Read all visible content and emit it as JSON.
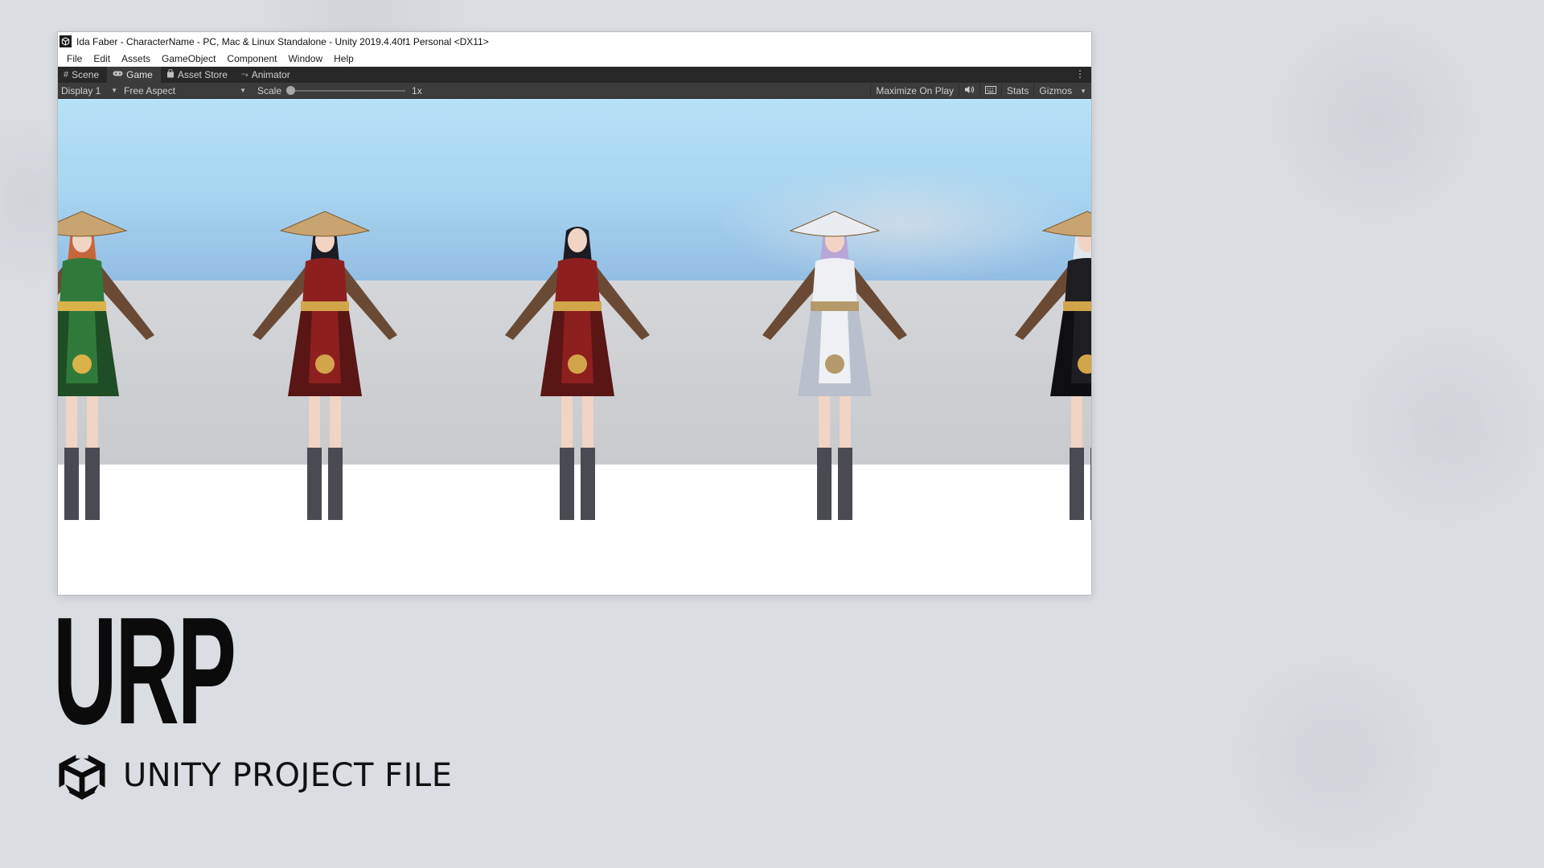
{
  "window": {
    "title": "Ida Faber - CharacterName - PC, Mac & Linux Standalone - Unity 2019.4.40f1 Personal <DX11>",
    "app_icon": "unity-icon"
  },
  "menu": [
    "File",
    "Edit",
    "Assets",
    "GameObject",
    "Component",
    "Window",
    "Help"
  ],
  "tabs": [
    {
      "label": "Scene",
      "icon": "grid-icon",
      "glyph": "#"
    },
    {
      "label": "Game",
      "icon": "gamepad-icon",
      "glyph": "🎮",
      "active": true
    },
    {
      "label": "Asset Store",
      "icon": "bag-icon",
      "glyph": "🔒"
    },
    {
      "label": "Animator",
      "icon": "animator-icon",
      "glyph": "⤳"
    }
  ],
  "game_toolbar": {
    "display": "Display 1",
    "aspect": "Free Aspect",
    "scale_label": "Scale",
    "scale_value": "1x",
    "scale_fraction": 0.0,
    "maximize": "Maximize On Play",
    "stats": "Stats",
    "gizmos": "Gizmos"
  },
  "characters": [
    {
      "outfit": "green",
      "hat": true
    },
    {
      "outfit": "red",
      "hat": true
    },
    {
      "outfit": "red",
      "hat": false
    },
    {
      "outfit": "white",
      "hat": true
    },
    {
      "outfit": "black",
      "hat": true
    }
  ],
  "colors": {
    "editor_dark": "#282828",
    "toolbar": "#3c3c3c",
    "background": "#dadde2"
  },
  "hero": {
    "title": "URP",
    "subtitle": "UNITY PROJECT FILE",
    "logo": "unity-logo-icon"
  }
}
